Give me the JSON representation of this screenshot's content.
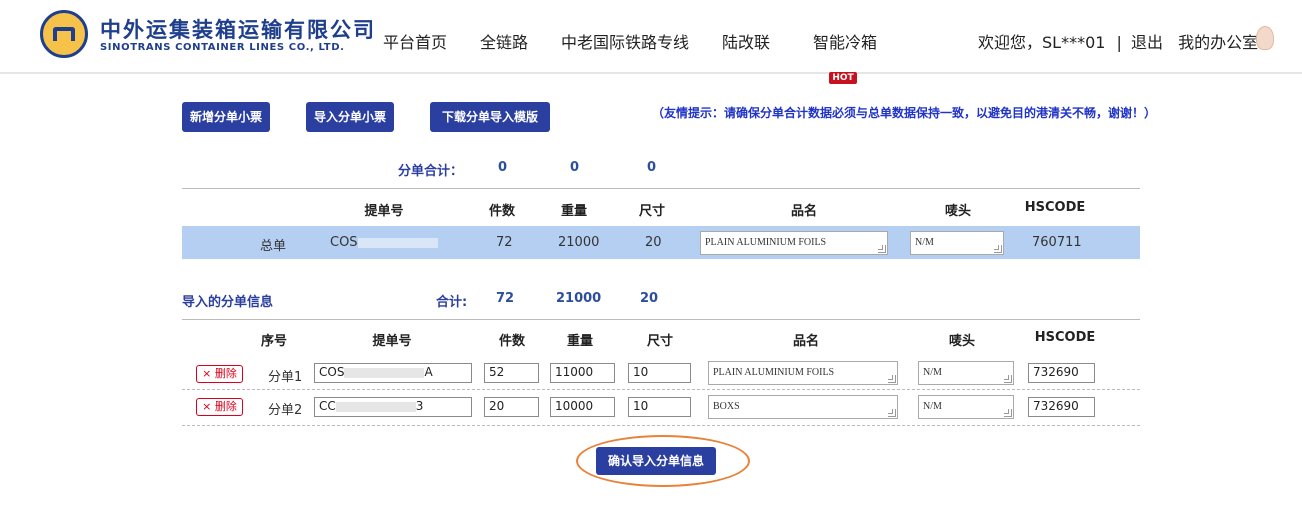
{
  "header": {
    "logo_cn": "中外运集装箱运输有限公司",
    "logo_en": "SINOTRANS CONTAINER LINES CO., LTD.",
    "nav": [
      "平台首页",
      "全链路",
      "中老国际铁路专线",
      "陆改联",
      "智能冷箱"
    ],
    "hot_badge": "HOT",
    "welcome": "欢迎您，SL***01",
    "separator": "|",
    "logout": "退出",
    "office": "我的办公室"
  },
  "toolbar": {
    "add_label": "新增分单小票",
    "import_label": "导入分单小票",
    "download_label": "下载分单导入模版",
    "tip": "（友情提示：请确保分单合计数据必须与总单数据保持一致，以避免目的港清关不畅，谢谢！）"
  },
  "summary": {
    "label": "分单合计：",
    "pieces": "0",
    "weight": "0",
    "size": "0"
  },
  "master_table": {
    "headers": [
      "提单号",
      "件数",
      "重量",
      "尺寸",
      "品名",
      "唛头",
      "HSCODE"
    ],
    "row": {
      "type": "总单",
      "bl_no": "COS",
      "pieces": "72",
      "weight": "21000",
      "size": "20",
      "product": "PLAIN ALUMINIUM FOILS",
      "marks": "N/M",
      "hscode": "760711"
    }
  },
  "import_section": {
    "title": "导入的分单信息",
    "total_label": "合计:",
    "pieces": "72",
    "weight": "21000",
    "size": "20",
    "headers": [
      "序号",
      "提单号",
      "件数",
      "重量",
      "尺寸",
      "品名",
      "唛头",
      "HSCODE"
    ],
    "rows": [
      {
        "delete": "× 删除",
        "seq": "分单1",
        "bl_prefix": "COS",
        "bl_suffix": "A",
        "pieces": "52",
        "weight": "11000",
        "size": "10",
        "product": "PLAIN ALUMINIUM FOILS",
        "marks": "N/M",
        "hscode": "732690"
      },
      {
        "delete": "× 删除",
        "seq": "分单2",
        "bl_prefix": "CC",
        "bl_suffix": "3",
        "pieces": "20",
        "weight": "10000",
        "size": "10",
        "product": "BOXS",
        "marks": "N/M",
        "hscode": "732690"
      }
    ]
  },
  "confirm_label": "确认导入分单信息",
  "colors": {
    "brand_blue": "#2b3fa0",
    "logo_gold": "#f6c24a",
    "row_highlight": "#b5cff2",
    "delete_red": "#d9001b",
    "annotation_orange": "#e8823a",
    "hot_red": "#c8111e"
  }
}
